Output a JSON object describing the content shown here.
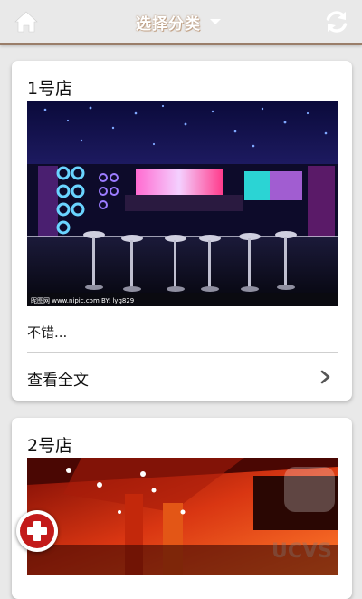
{
  "topbar": {
    "title": "选择分类",
    "home_icon": "home-icon",
    "refresh_icon": "refresh-icon",
    "caret_icon": "caret-down-icon"
  },
  "cards": [
    {
      "title": "1号店",
      "image_caption": "昵图网 www.nipic.com  BY: lyg829",
      "excerpt": "不错...",
      "read_more": "查看全文"
    },
    {
      "title": "2号店"
    }
  ],
  "fab": {
    "icon": "plus-icon"
  },
  "watermark": "UCVS",
  "colors": {
    "topbar_bg": "#e9e9e9",
    "title_outline": "#b89b82",
    "fab_red": "#c31a1a",
    "page_bg": "#e9e9e9"
  }
}
